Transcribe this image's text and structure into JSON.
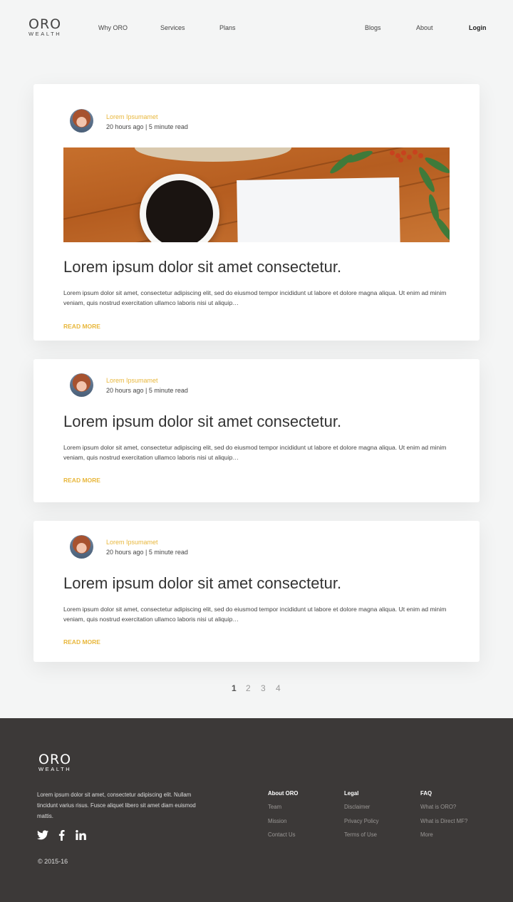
{
  "header": {
    "logo_main": "ORO",
    "logo_sub": "WEALTH",
    "nav": {
      "why": "Why ORO",
      "services": "Services",
      "plans": "Plans",
      "blogs": "Blogs",
      "about": "About",
      "login": "Login"
    }
  },
  "posts": [
    {
      "author": "Lorem Ipsumamet",
      "meta": "20 hours ago | 5 minute read",
      "title": "Lorem ipsum dolor sit amet consectetur.",
      "excerpt": "Lorem ipsum dolor sit amet, consectetur adipiscing elit, sed do eiusmod tempor incididunt ut labore et dolore magna aliqua. Ut enim ad minim veniam, quis nostrud exercitation ullamco laboris nisi ut aliquip…",
      "read_more": "READ MORE"
    },
    {
      "author": "Lorem Ipsumamet",
      "meta": "20 hours ago | 5 minute read",
      "title": "Lorem ipsum dolor sit amet consectetur.",
      "excerpt": "Lorem ipsum dolor sit amet, consectetur adipiscing elit, sed do eiusmod tempor incididunt ut labore et dolore magna aliqua. Ut enim ad minim veniam, quis nostrud exercitation ullamco laboris nisi ut aliquip…",
      "read_more": "READ MORE"
    },
    {
      "author": "Lorem Ipsumamet",
      "meta": "20 hours ago | 5 minute read",
      "title": "Lorem ipsum dolor sit amet consectetur.",
      "excerpt": "Lorem ipsum dolor sit amet, consectetur adipiscing elit, sed do eiusmod tempor incididunt ut labore et dolore magna aliqua. Ut enim ad minim veniam, quis nostrud exercitation ullamco laboris nisi ut aliquip…",
      "read_more": "READ MORE"
    }
  ],
  "pagination": {
    "pages": [
      "1",
      "2",
      "3",
      "4"
    ],
    "current": "1"
  },
  "footer": {
    "logo_main": "ORO",
    "logo_sub": "WEALTH",
    "about_text": "Lorem ipsum dolor sit amet, consectetur adipiscing elit. Nullam tincidunt varius risus. Fusce aliquet libero sit amet diam euismod mattis.",
    "social_icons": [
      "twitter-icon",
      "facebook-icon",
      "linkedin-icon"
    ],
    "copyright": "© 2015-16",
    "columns": [
      {
        "heading": "About ORO",
        "items": [
          "Team",
          "Mission",
          "Contact Us"
        ]
      },
      {
        "heading": "Legal",
        "items": [
          "Disclaimer",
          "Privacy Policy",
          "Terms of Use"
        ]
      },
      {
        "heading": "FAQ",
        "items": [
          "What is ORO?",
          "What is Direct MF?",
          "More"
        ]
      }
    ]
  },
  "colors": {
    "accent": "#e8b73c",
    "page_bg": "#f4f5f5",
    "footer_bg": "#3c3938"
  }
}
